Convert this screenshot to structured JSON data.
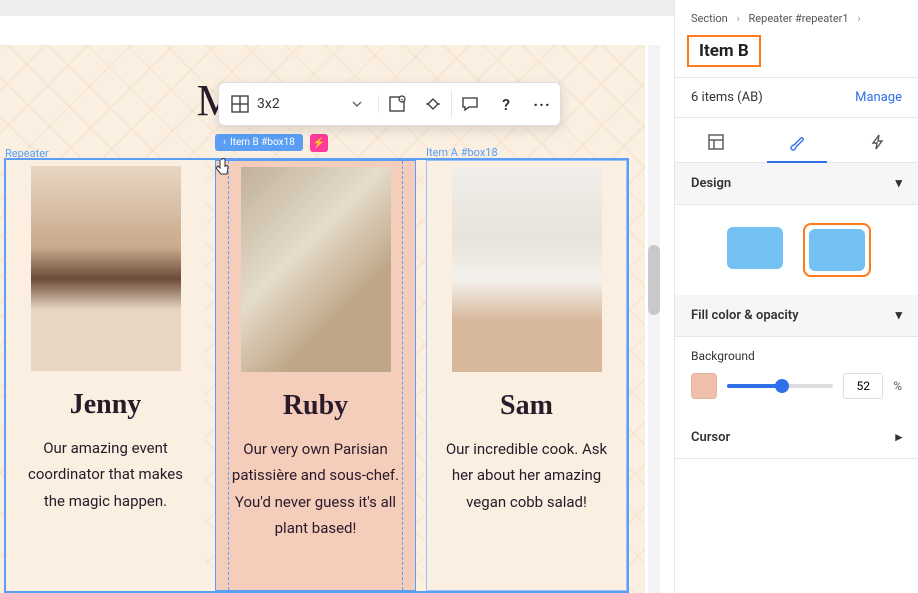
{
  "page": {
    "title": "Meet the team"
  },
  "repeater": {
    "label": "Repeater",
    "itemB_tag": "Item B #box18",
    "itemA_tag": "Item A #box18"
  },
  "floating_toolbar": {
    "grid_value": "3x2",
    "icons": {
      "grid": "grid-icon",
      "container": "container-icon",
      "animate": "animate-icon",
      "comment": "comment-icon",
      "help": "help-icon",
      "more": "more-icon"
    }
  },
  "cards": [
    {
      "name": "Jenny",
      "desc": "Our amazing event coordinator that makes the magic happen."
    },
    {
      "name": "Ruby",
      "desc": "Our very own Parisian patissière and sous-chef. You'd never guess it's all plant based!"
    },
    {
      "name": "Sam",
      "desc": "Our incredible cook. Ask her about her amazing vegan cobb salad!"
    }
  ],
  "sidebar": {
    "breadcrumbs": [
      "Section",
      "Repeater #repeater1"
    ],
    "selection_label": "Item B",
    "items_count_text": "6 items (AB)",
    "manage_label": "Manage",
    "accordion": {
      "design": "Design",
      "fill": "Fill color & opacity",
      "cursor": "Cursor"
    },
    "background": {
      "label": "Background",
      "swatch_color": "#f0bfa9",
      "opacity_value": "52",
      "opacity_unit": "%"
    },
    "design_swatches": [
      {
        "selected": false,
        "color": "#72c1f2"
      },
      {
        "selected": true,
        "color": "#72c1f2"
      }
    ]
  }
}
